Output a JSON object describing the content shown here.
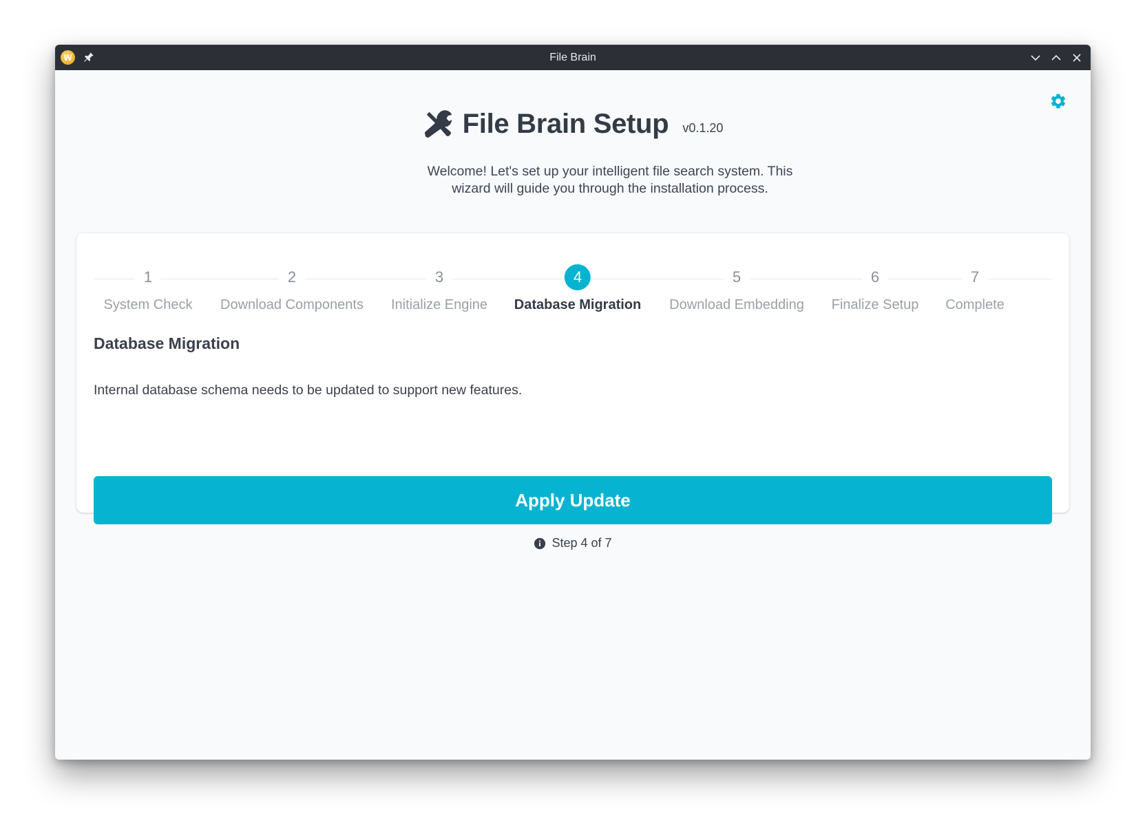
{
  "window": {
    "title": "File Brain",
    "app_icon_letter": "W"
  },
  "header": {
    "title": "File Brain Setup",
    "version": "v0.1.20",
    "subtitle": "Welcome! Let's set up your intelligent file search system. This wizard will guide you through the installation process."
  },
  "stepper": {
    "active_step": 4,
    "steps": [
      {
        "number": "1",
        "label": "System Check"
      },
      {
        "number": "2",
        "label": "Download Components"
      },
      {
        "number": "3",
        "label": "Initialize Engine"
      },
      {
        "number": "4",
        "label": "Database Migration"
      },
      {
        "number": "5",
        "label": "Download Embedding"
      },
      {
        "number": "6",
        "label": "Finalize Setup"
      },
      {
        "number": "7",
        "label": "Complete"
      }
    ]
  },
  "section": {
    "title": "Database Migration",
    "description": "Internal database schema needs to be updated to support new features.",
    "button_label": "Apply Update"
  },
  "footer": {
    "step_text": "Step 4 of 7"
  },
  "colors": {
    "accent": "#06b4d1",
    "titlebar": "#2c3036",
    "text": "#343a46"
  },
  "icons": {
    "app": "app-logo-icon",
    "pin": "pin-icon",
    "settings": "gear-icon",
    "header": "tools-icon",
    "footer": "info-icon"
  }
}
